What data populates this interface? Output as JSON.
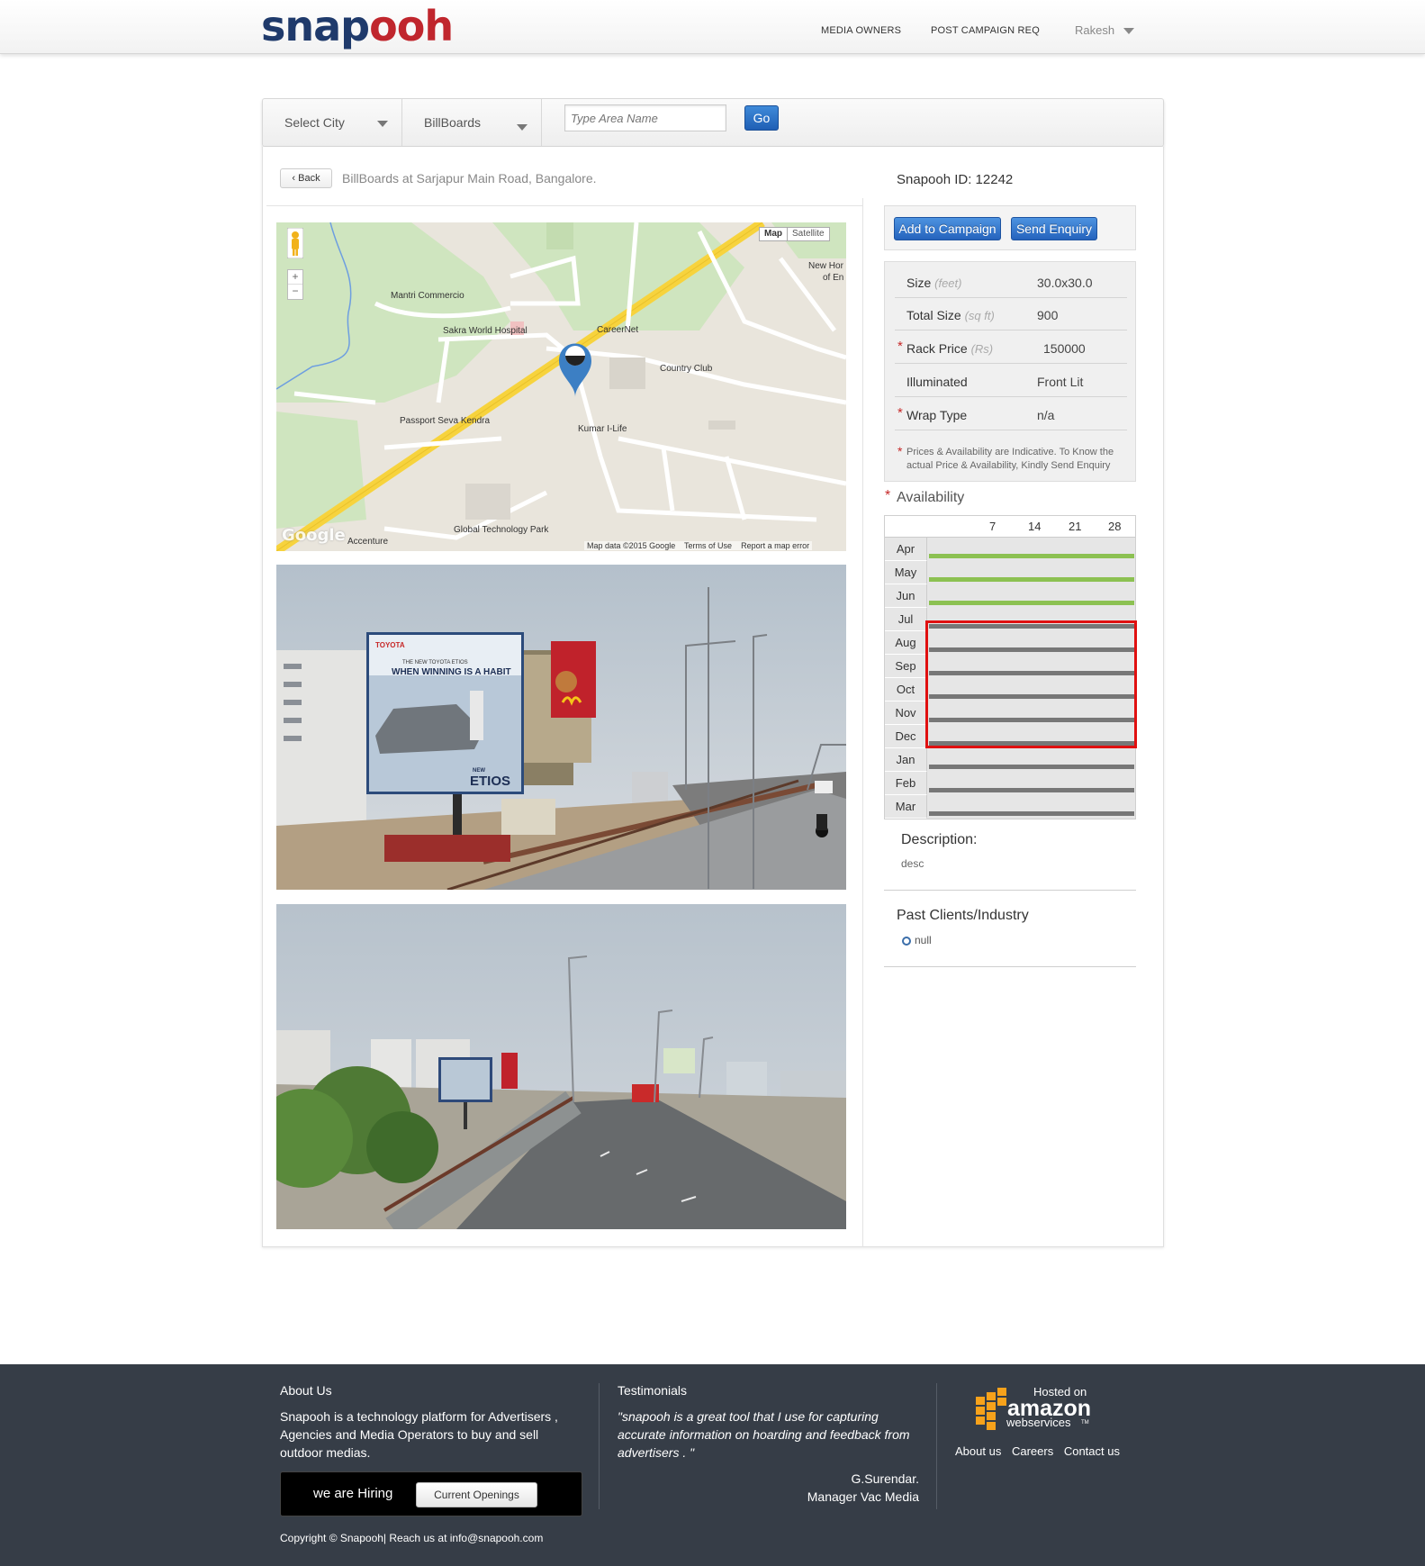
{
  "header": {
    "logo_a": "snap",
    "logo_b": "ooh",
    "nav": [
      "MEDIA OWNERS",
      "POST CAMPAIGN REQ"
    ],
    "user": "Rakesh"
  },
  "search": {
    "city": "Select City",
    "media": "BillBoards",
    "placeholder": "Type Area Name",
    "go": "Go"
  },
  "page": {
    "back": "Back",
    "breadcrumb": "BillBoards at Sarjapur Main Road, Bangalore.",
    "snapooh_id": "Snapooh ID: 12242"
  },
  "map": {
    "toggle_map": "Map",
    "toggle_satellite": "Satellite",
    "labels": [
      "Mantri Commercio",
      "Sakra World Hospital",
      "CareerNet",
      "Country Club",
      "Passport Seva Kendra",
      "Kumar I-Life",
      "Global Technology Park",
      "Accenture",
      "New Hor",
      "of En"
    ],
    "google": "Google",
    "map_data": "Map data ©2015 Google",
    "terms": "Terms of Use",
    "report": "Report a map error"
  },
  "photo1": {
    "brand": "TOYOTA",
    "headline": "THE NEW TOYOTA ETIOS",
    "tagline": "WHEN WINNING IS A HABIT",
    "model_new": "NEW",
    "model": "ETIOS"
  },
  "actions": {
    "add": "Add to Campaign",
    "enquiry": "Send Enquiry"
  },
  "specs": [
    {
      "key": "Size",
      "unit": "(feet)",
      "value": "30.0x30.0",
      "star": ""
    },
    {
      "key": "Total Size",
      "unit": "(sq ft)",
      "value": "900",
      "star": ""
    },
    {
      "key": "Rack Price",
      "unit": "(Rs)",
      "value": "150000",
      "star": "*"
    },
    {
      "key": "Illuminated",
      "unit": "",
      "value": "Front Lit",
      "star": ""
    },
    {
      "key": "Wrap Type",
      "unit": "",
      "value": "n/a",
      "star": "*"
    }
  ],
  "specs_note": "Prices & Availability are Indicative. To Know the actual Price & Availability, Kindly Send Enquiry",
  "specs_note_star": "*",
  "availability": {
    "title": "Availability",
    "star": "*",
    "day_ticks": [
      "7",
      "14",
      "21",
      "28"
    ],
    "months": [
      "Apr",
      "May",
      "Jun",
      "Jul",
      "Aug",
      "Sep",
      "Oct",
      "Nov",
      "Dec",
      "Jan",
      "Feb",
      "Mar"
    ],
    "status": [
      "available",
      "available",
      "available",
      "booked",
      "booked",
      "booked",
      "booked",
      "booked",
      "booked",
      "booked",
      "booked",
      "booked"
    ],
    "colors": {
      "available": "#8cc152",
      "booked": "#777777"
    }
  },
  "description": {
    "title": "Description:",
    "text": "desc"
  },
  "past_clients": {
    "title": "Past Clients/Industry",
    "item": "null"
  },
  "footer": {
    "about_title": "About Us",
    "about_text": "Snapooh is a technology platform for Advertisers , Agencies and Media Operators to buy and sell outdoor medias.",
    "hiring": "we are Hiring",
    "openings": "Current Openings",
    "copyright": "Copyright © Snapooh| Reach us at info@snapooh.com",
    "testimonials_title": "Testimonials",
    "quote": "\"snapooh is a great tool that I use for capturing accurate information on hoarding and feedback from advertisers . \"",
    "author": "G.Surendar.",
    "author_role": "Manager Vac Media",
    "aws_hosted": "Hosted on",
    "aws_amazon": "amazon",
    "aws_web": "webservices",
    "aws_tm": "TM",
    "links": [
      "About us",
      "Careers",
      "Contact us"
    ]
  }
}
